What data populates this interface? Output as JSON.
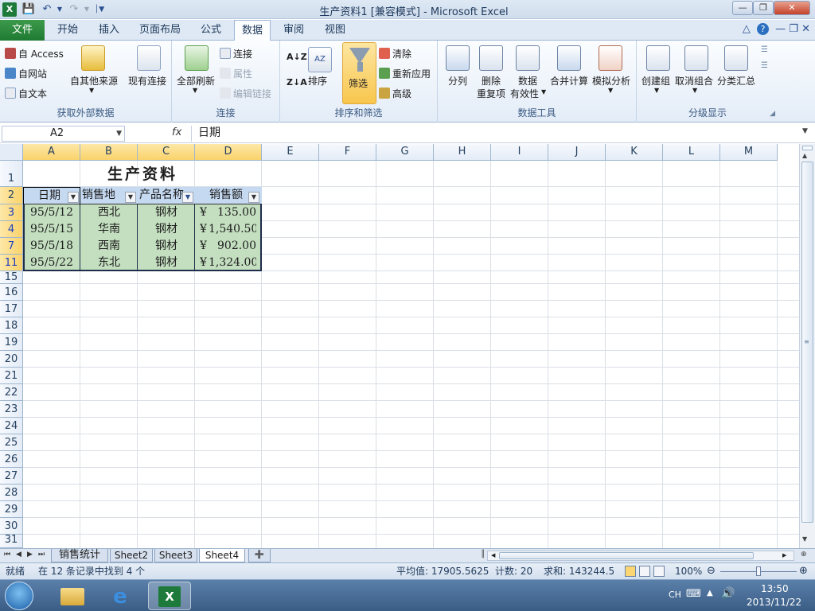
{
  "window": {
    "title": "生产资料1  [兼容模式] - Microsoft Excel",
    "app_icon": "X"
  },
  "menu_tabs": [
    {
      "label": "文件"
    },
    {
      "label": "开始"
    },
    {
      "label": "插入"
    },
    {
      "label": "页面布局"
    },
    {
      "label": "公式"
    },
    {
      "label": "数据"
    },
    {
      "label": "审阅"
    },
    {
      "label": "视图"
    }
  ],
  "ribbon": {
    "groups": [
      {
        "label": "获取外部数据"
      },
      {
        "label": "连接"
      },
      {
        "label": "排序和筛选"
      },
      {
        "label": "数据工具"
      },
      {
        "label": "分级显示"
      }
    ],
    "get_external": {
      "access": "自 Access",
      "web": "自网站",
      "text": "自文本",
      "other": "自其他来源",
      "existing": "现有连接"
    },
    "connections": {
      "refresh_all": "全部刷新",
      "connections": "连接",
      "properties": "属性",
      "edit_links": "编辑链接"
    },
    "sort_filter": {
      "sort": "排序",
      "filter": "筛选",
      "clear": "清除",
      "reapply": "重新应用",
      "advanced": "高级"
    },
    "data_tools": {
      "text_to_columns": "分列",
      "remove_dup_1": "删除",
      "remove_dup_2": "重复项",
      "validation_1": "数据",
      "validation_2": "有效性",
      "consolidate": "合并计算",
      "what_if": "模拟分析"
    },
    "outline": {
      "group": "创建组",
      "ungroup": "取消组合",
      "subtotal": "分类汇总"
    }
  },
  "formula_bar": {
    "name_box": "A2",
    "fx": "fx",
    "content": "日期"
  },
  "columns": [
    "A",
    "B",
    "C",
    "D",
    "E",
    "F",
    "G",
    "H",
    "I",
    "J",
    "K",
    "L",
    "M"
  ],
  "rows": [
    "1",
    "2",
    "3",
    "4",
    "7",
    "11",
    "15",
    "16",
    "17",
    "18",
    "19",
    "20",
    "21",
    "22",
    "23",
    "24",
    "25",
    "26",
    "27",
    "28",
    "29",
    "30",
    "31"
  ],
  "sheet": {
    "title": "生产资料",
    "headers": [
      "日期",
      "销售地",
      "产品名称",
      "销售额"
    ],
    "data": [
      {
        "date": "95/5/12",
        "region": "西北",
        "product": "钢材",
        "currency": "¥",
        "amount": "135.00"
      },
      {
        "date": "95/5/15",
        "region": "华南",
        "product": "钢材",
        "currency": "¥",
        "amount": "1,540.50"
      },
      {
        "date": "95/5/18",
        "region": "西南",
        "product": "钢材",
        "currency": "¥",
        "amount": "902.00"
      },
      {
        "date": "95/5/22",
        "region": "东北",
        "product": "钢材",
        "currency": "¥",
        "amount": "1,324.00"
      }
    ]
  },
  "sheet_tabs": [
    {
      "label": "销售统计",
      "active": false
    },
    {
      "label": "Sheet2",
      "active": false
    },
    {
      "label": "Sheet3",
      "active": false
    },
    {
      "label": "Sheet4",
      "active": true
    }
  ],
  "status": {
    "ready": "就绪",
    "filter_msg": "在 12 条记录中找到 4 个",
    "average": "平均值: 17905.5625",
    "count": "计数: 20",
    "sum": "求和: 143244.5",
    "zoom": "100%"
  },
  "taskbar": {
    "lang": "CH",
    "time": "13:50",
    "date": "2013/11/22"
  },
  "colors": {
    "filter_active": "#f8c64d",
    "table_fill": "#c4dfc0",
    "header_fill": "#c5d9f1",
    "file_tab": "#1f7a32"
  }
}
